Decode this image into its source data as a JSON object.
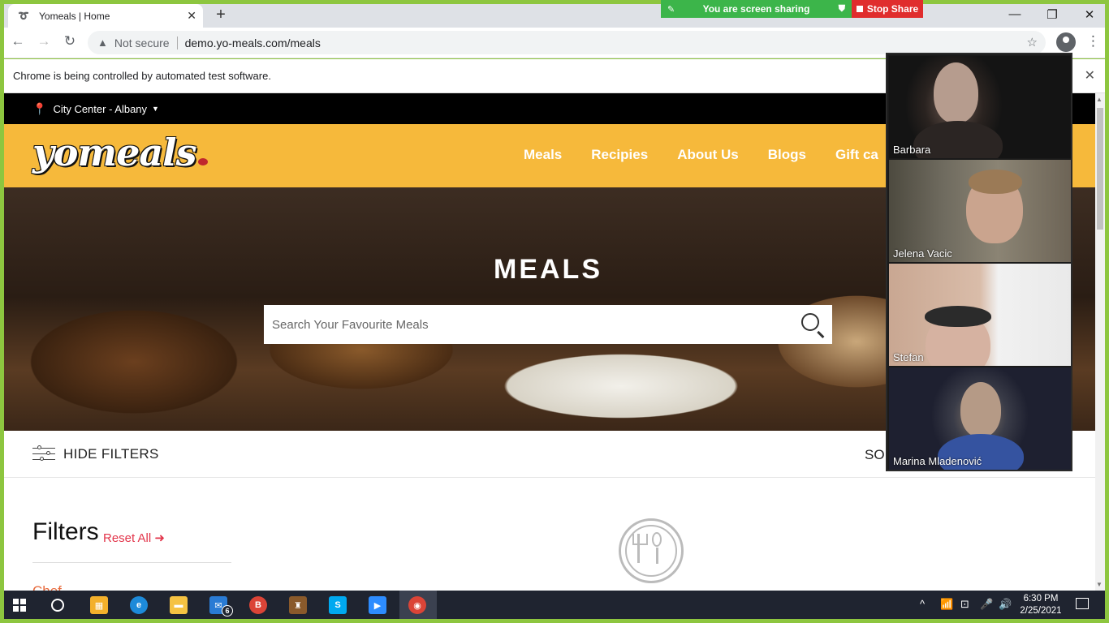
{
  "browser": {
    "tab_title": "Yomeals | Home",
    "new_tab_symbol": "+",
    "security_label": "Not secure",
    "url": "demo.yo-meals.com/meals",
    "automation_notice": "Chrome is being controlled by automated test software."
  },
  "screen_share": {
    "message": "You are screen sharing",
    "stop_label": "Stop Share"
  },
  "site": {
    "location": "City Center - Albany",
    "logo_text": "yomeals",
    "nav": [
      "Meals",
      "Recipies",
      "About Us",
      "Blogs",
      "Gift ca"
    ],
    "hero_title": "MEALS",
    "search_placeholder": "Search Your Favourite Meals",
    "hide_filters_label": "HIDE FILTERS",
    "sort_label": "SO",
    "filters_title": "Filters",
    "reset_all_label": "Reset All ➜",
    "first_filter_cut": "Chef"
  },
  "video_call": {
    "participants": [
      "Barbara",
      "Jelena Vacic",
      "Stefan",
      "Marina Mladenović"
    ]
  },
  "taskbar": {
    "mail_badge": "6",
    "time": "6:30 PM",
    "date": "2/25/2021",
    "icons": [
      "windows-start",
      "cortana",
      "store",
      "edge",
      "file-explorer",
      "mail",
      "chrome-profile",
      "game-app",
      "skype",
      "zoom",
      "chrome"
    ]
  },
  "colors": {
    "header_yellow": "#f6b93b",
    "accent_red": "#e2344a",
    "share_green": "#3cb54a",
    "stop_red": "#e02d2d",
    "frame_green": "#8dc63f"
  }
}
